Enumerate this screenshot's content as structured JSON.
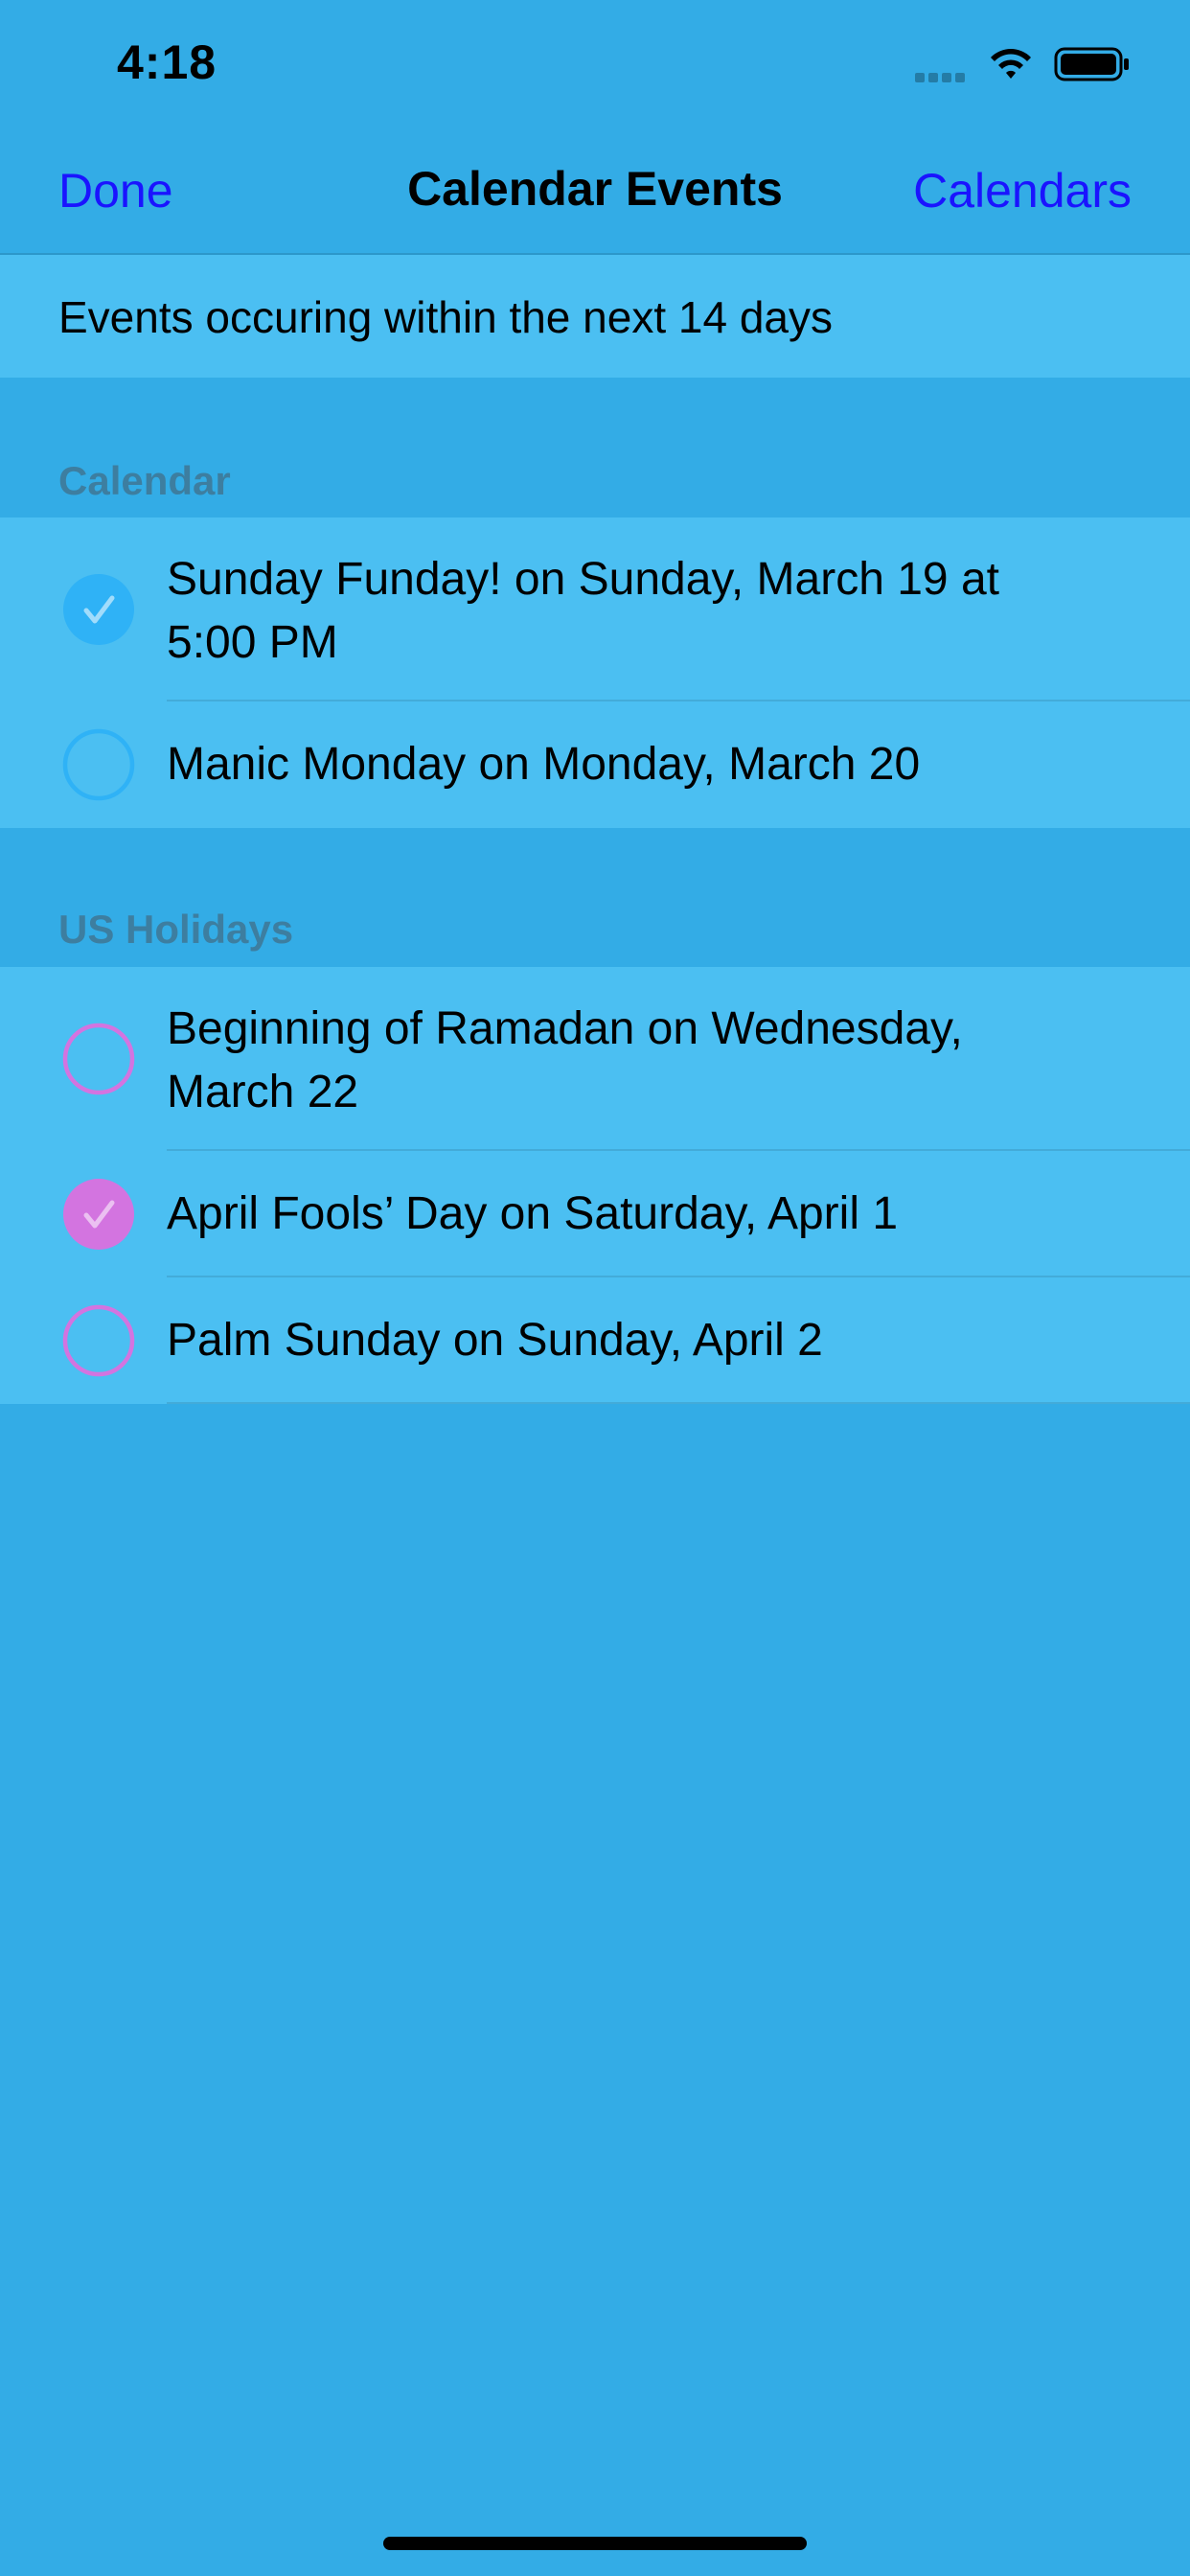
{
  "status_bar": {
    "time": "4:18",
    "icons": [
      "signal-icon",
      "wifi-icon",
      "battery-icon"
    ]
  },
  "nav": {
    "left_button": "Done",
    "title": "Calendar Events",
    "right_button": "Calendars",
    "button_color": "#1a14ff"
  },
  "info": {
    "text": "Events occuring within the next 14 days"
  },
  "sections": [
    {
      "header": "Calendar",
      "color": "#2fb2f6",
      "events": [
        {
          "text": "Sunday Funday! on Sunday, March 19 at 5:00 PM",
          "checked": true
        },
        {
          "text": "Manic Monday on Monday, March 20",
          "checked": false
        }
      ]
    },
    {
      "header": "US Holidays",
      "color": "#d374e0",
      "events": [
        {
          "text": "Beginning of Ramadan on Wednesday, March 22",
          "checked": false
        },
        {
          "text": "April Fools’ Day on Saturday, April 1",
          "checked": true
        },
        {
          "text": "Palm Sunday on Sunday, April 2",
          "checked": false
        }
      ]
    }
  ],
  "theme": {
    "background": "#33ace6",
    "cell_background": "#4bbff2",
    "section_header_color": "#3d7ea0"
  }
}
